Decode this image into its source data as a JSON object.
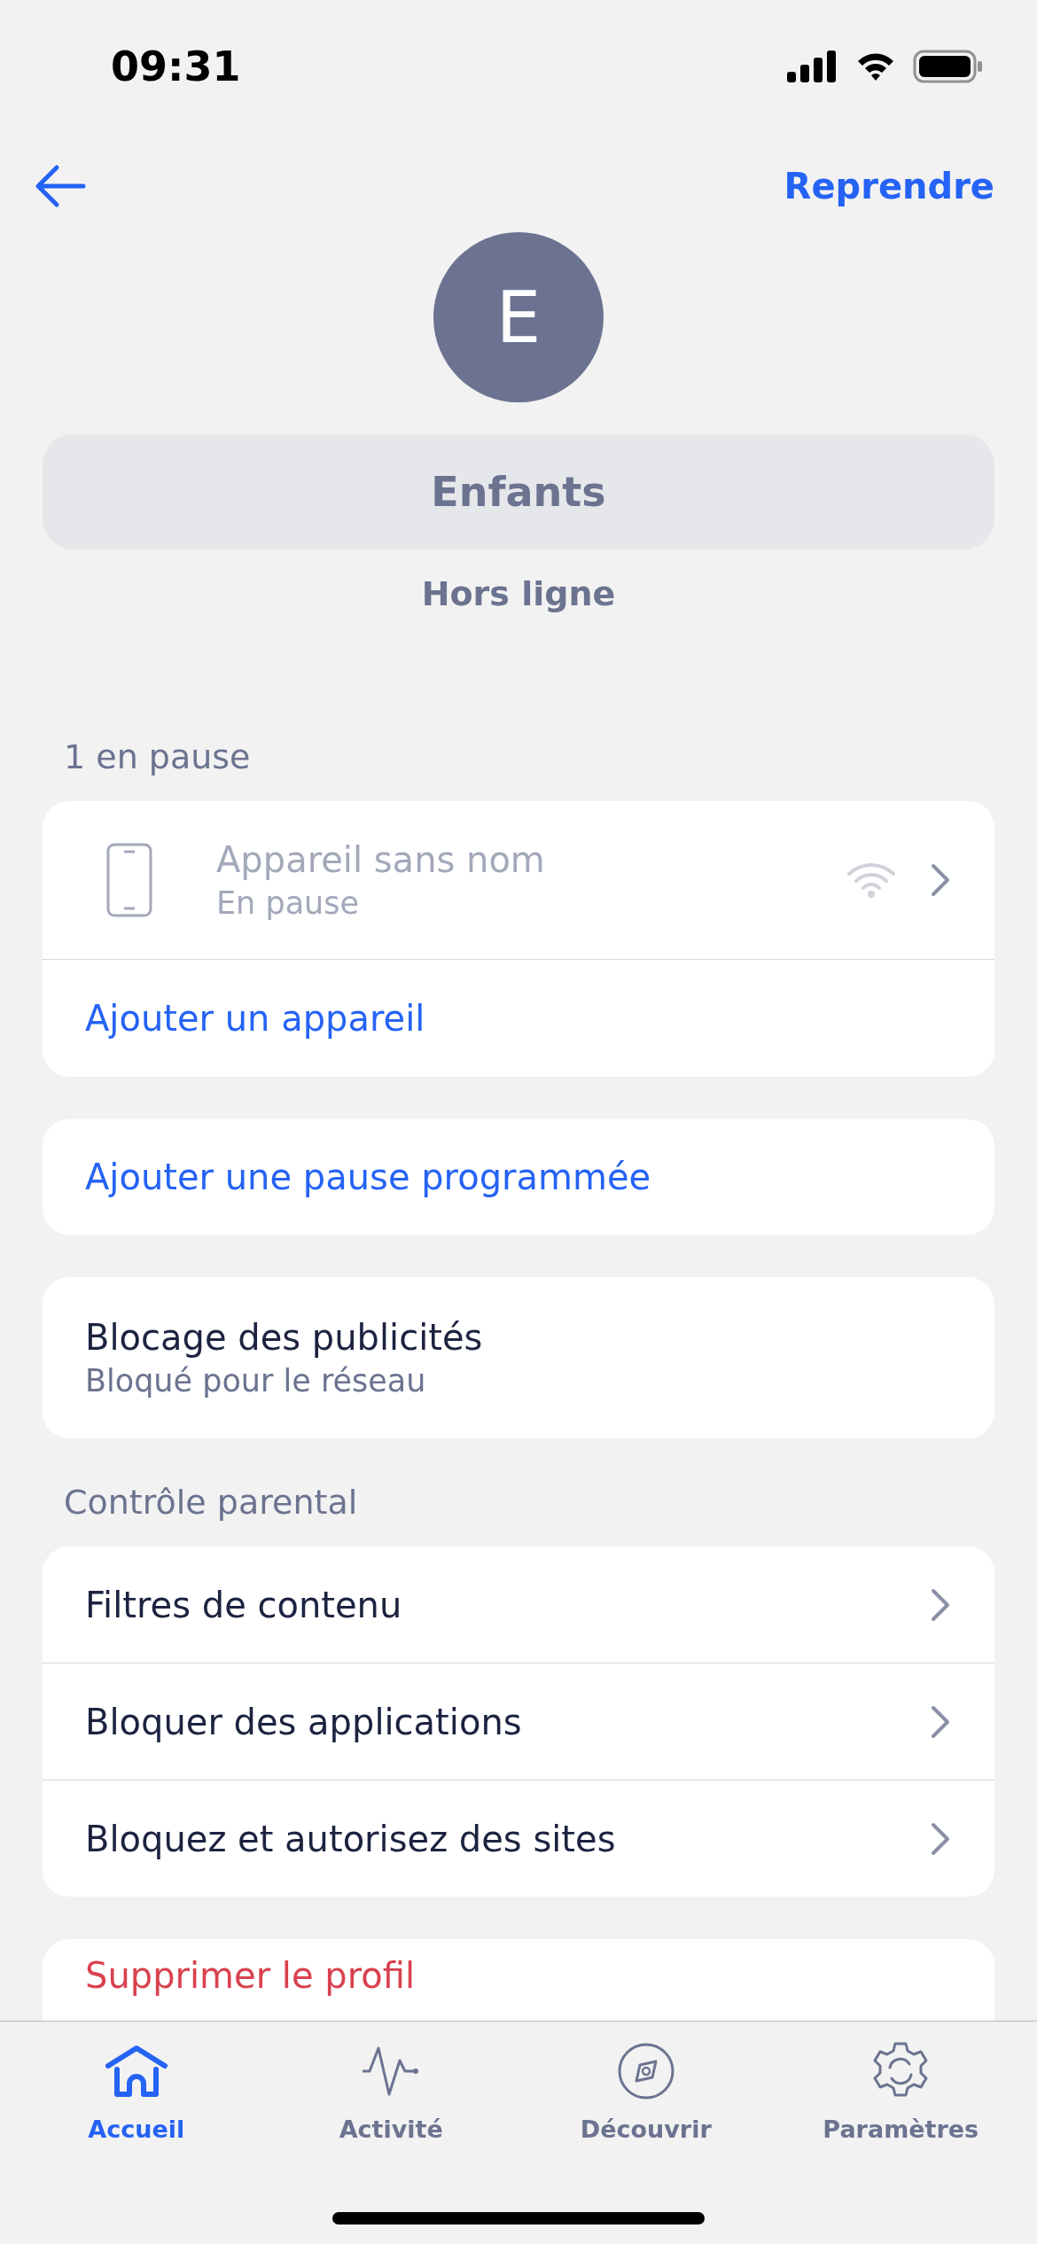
{
  "status_bar": {
    "time": "09:31"
  },
  "nav": {
    "action": "Reprendre"
  },
  "profile": {
    "initial": "E",
    "name": "Enfants",
    "status": "Hors ligne"
  },
  "paused_section": {
    "title": "1 en pause",
    "devices": [
      {
        "name": "Appareil sans nom",
        "status": "En pause",
        "paused": true
      }
    ],
    "add_label": "Ajouter un appareil"
  },
  "schedule": {
    "label": "Ajouter une pause programmée"
  },
  "ad_blocking": {
    "title": "Blocage des publicités",
    "subtitle": "Bloqué pour le réseau"
  },
  "parental": {
    "title": "Contrôle parental",
    "items": [
      "Filtres de contenu",
      "Bloquer des applications",
      "Bloquez et autorisez des sites"
    ]
  },
  "delete": {
    "label": "Supprimer le profil"
  },
  "tabs": [
    {
      "label": "Accueil",
      "kind": "home",
      "selected": true
    },
    {
      "label": "Activité",
      "kind": "activity",
      "selected": false
    },
    {
      "label": "Découvrir",
      "kind": "discover",
      "selected": false
    },
    {
      "label": "Paramètres",
      "kind": "settings",
      "selected": false
    }
  ]
}
